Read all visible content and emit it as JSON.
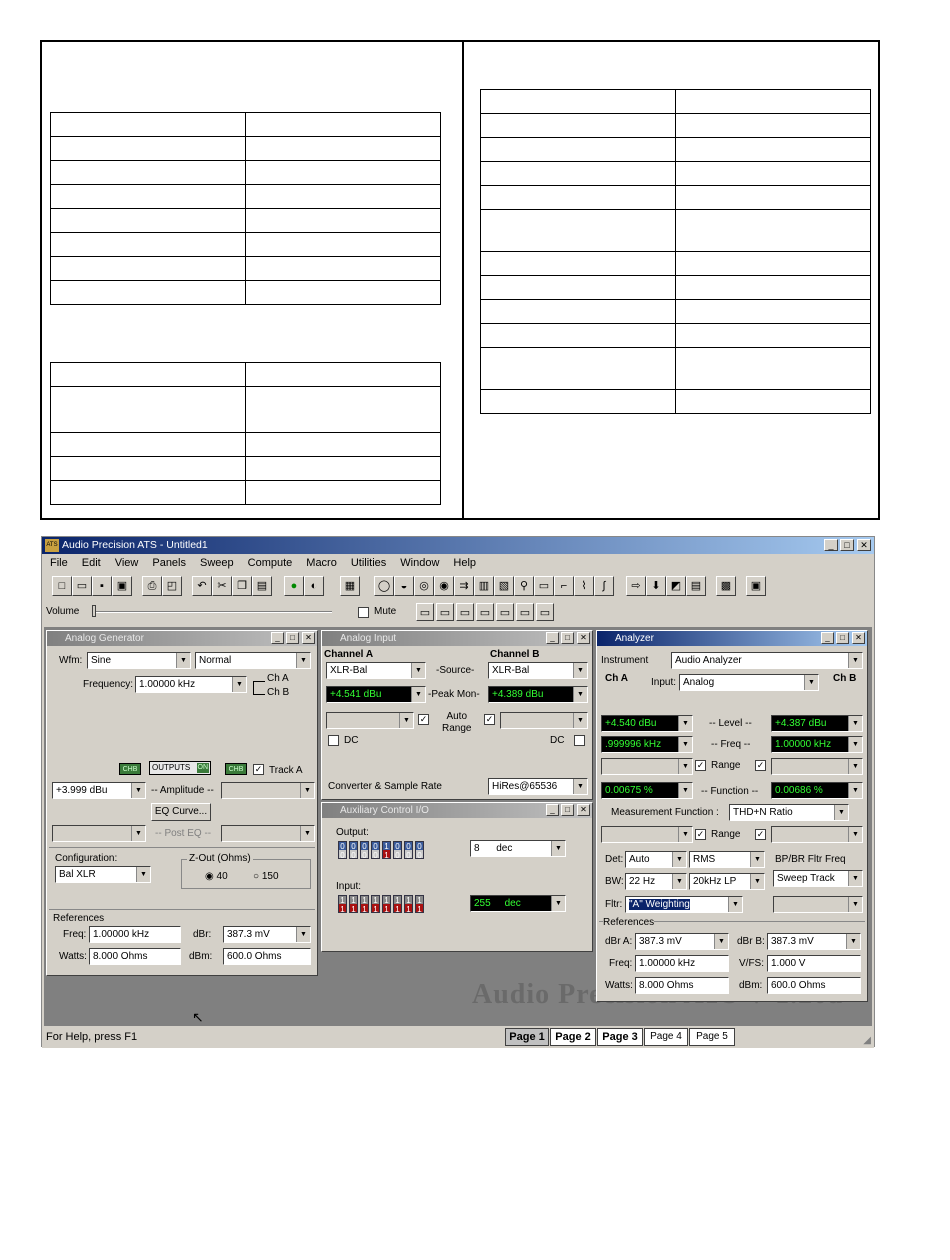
{
  "app": {
    "title": "Audio Precision ATS - Untitled1",
    "menus": [
      "File",
      "Edit",
      "View",
      "Panels",
      "Sweep",
      "Compute",
      "Macro",
      "Utilities",
      "Window",
      "Help"
    ],
    "volume_label": "Volume",
    "mute_label": "Mute",
    "status_text": "For Help, press F1",
    "pages": [
      "Page 1",
      "Page 2",
      "Page 3",
      "Page 4",
      "Page 5"
    ],
    "watermark": "Audio Precision ATS V  1.20a"
  },
  "generator": {
    "title": "Analog Generator",
    "wfm_label": "Wfm:",
    "wfm_value": "Sine",
    "wfm_mode": "Normal",
    "frequency_label": "Frequency:",
    "frequency_value": "1.00000 kHz",
    "cha": "Ch A",
    "chb": "Ch B",
    "ch_b_badge": "CHB",
    "outputs_label": "OUTPUTS",
    "on_label": "ON",
    "track_a": "Track A",
    "amplitude_value": "+3.999  dBu",
    "amplitude_label": "-- Amplitude --",
    "eq_curve": "EQ Curve...",
    "post_eq": "-- Post EQ --",
    "configuration_label": "Configuration:",
    "configuration_value": "Bal XLR",
    "zout_label": "Z-Out (Ohms)",
    "zout_40": "40",
    "zout_150": "150",
    "references_label": "References",
    "freq_label": "Freq:",
    "freq_ref": "1.00000 kHz",
    "watts_label": "Watts:",
    "watts_ref": "8.000    Ohms",
    "dbr_label": "dBr:",
    "dbr_ref": "387.3   mV",
    "dbm_label": "dBm:",
    "dbm_ref": "600.0    Ohms"
  },
  "input": {
    "title": "Analog Input",
    "channel_a": "Channel A",
    "channel_b": "Channel B",
    "source_label": "-Source-",
    "source_a": "XLR-Bal",
    "source_b": "XLR-Bal",
    "peak_label": "-Peak Mon-",
    "peak_a": "+4.541   dBu",
    "peak_b": "+4.389   dBu",
    "auto_range": "Auto\nRange",
    "dc": "DC",
    "converter_label": "Converter & Sample Rate",
    "converter_value": "HiRes@65536"
  },
  "aux": {
    "title": "Auxiliary Control I/O",
    "output_label": "Output:",
    "output_value": "8",
    "output_fmt": "dec",
    "input_label": "Input:",
    "input_value": "255",
    "input_fmt": "dec"
  },
  "analyzer": {
    "title": "Analyzer",
    "instrument_label": "Instrument",
    "instrument_value": "Audio Analyzer",
    "cha": "Ch A",
    "chb": "Ch B",
    "input_label": "Input:",
    "input_value": "Analog",
    "level_a": "+4.540   dBu",
    "level_label": "-- Level --",
    "level_b": "+4.387   dBu",
    "freq_a": ".999996 kHz",
    "freq_label": "-- Freq --",
    "freq_b": "1.00000 kHz",
    "range_label": "Range",
    "function_a": "0.00675  %",
    "function_label": "-- Function --",
    "function_b": "0.00686  %",
    "meas_label": "Measurement Function :",
    "meas_value": "THD+N Ratio",
    "det_label": "Det:",
    "det_value": "Auto",
    "det_type": "RMS",
    "bpbr_label": "BP/BR Fltr Freq",
    "bw_label": "BW:",
    "bw_low": "22 Hz",
    "bw_high": "20kHz LP",
    "sweep_track": "Sweep Track",
    "fltr_label": "Fltr:",
    "fltr_value": "\"A\" Weighting",
    "references_label": "References",
    "dbra_label": "dBr A:",
    "dbra_value": "387.3   mV",
    "dbrb_label": "dBr B:",
    "dbrb_value": "387.3   mV",
    "freq_ref_label": "Freq:",
    "freq_ref_value": "1.00000 kHz",
    "vfs_label": "V/FS:",
    "vfs_value": "1.000     V",
    "watts_label": "Watts:",
    "watts_value": "8.000     Ohms",
    "dbm_label": "dBm:",
    "dbm_value": "600.0    Ohms"
  },
  "colors": {
    "titlebar": "#0a246a",
    "display_bg": "#000000",
    "display_fg": "#33ff33",
    "bit_red": "#aa1111"
  }
}
